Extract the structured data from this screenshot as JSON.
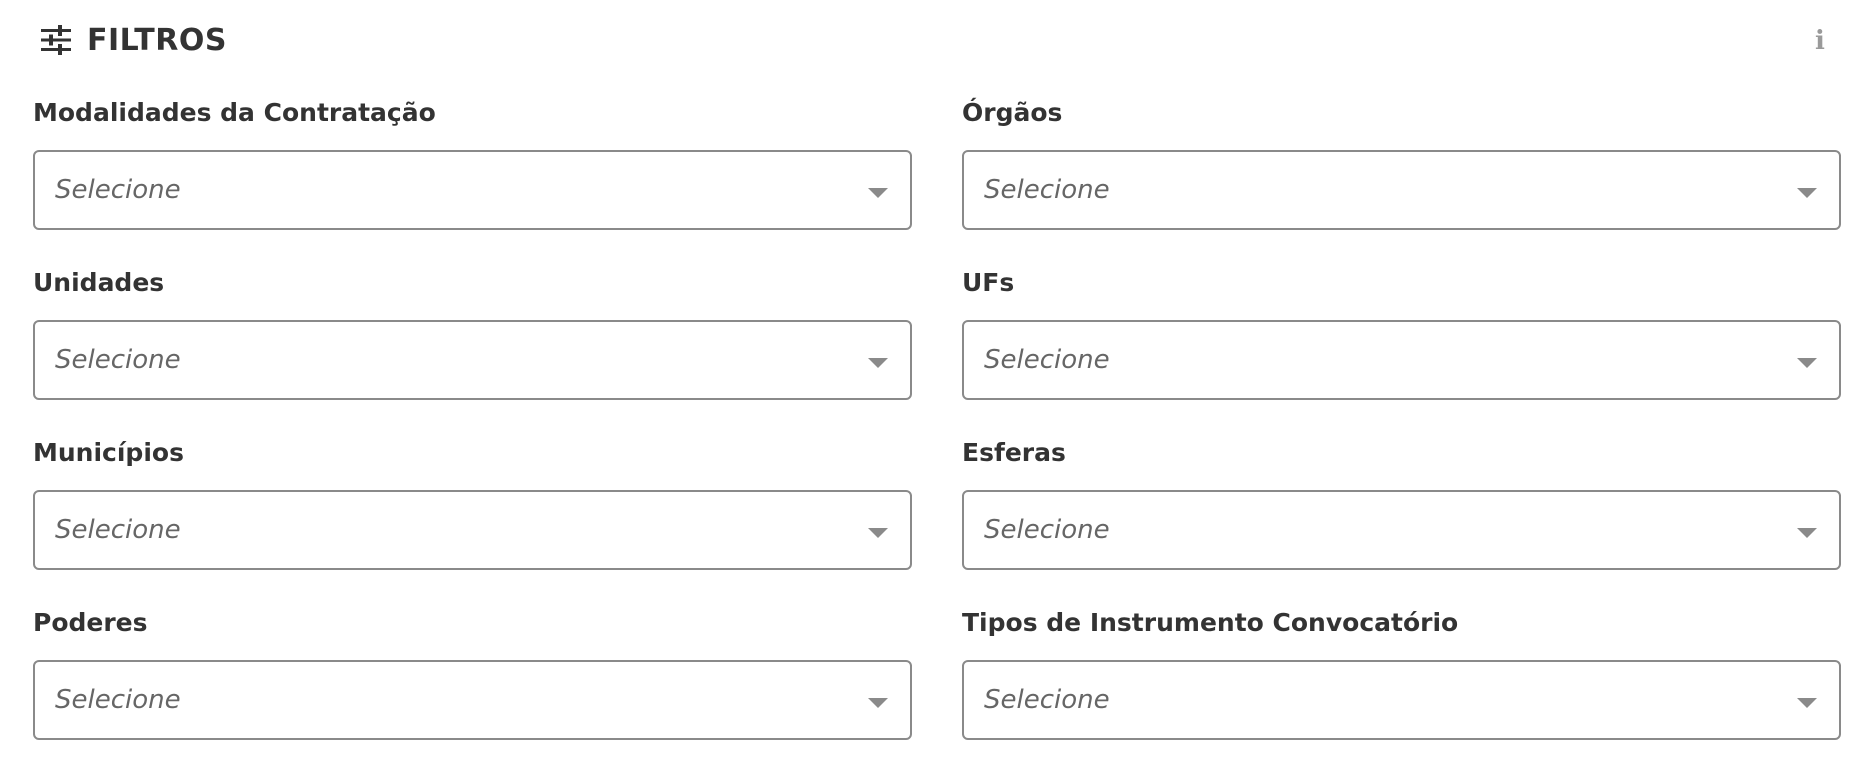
{
  "header": {
    "title": "FILTROS",
    "filter_icon": "sliders-icon",
    "info_icon": "info-icon",
    "info_glyph": "i"
  },
  "filters": [
    {
      "label": "Modalidades da Contratação",
      "placeholder": "Selecione"
    },
    {
      "label": "Órgãos",
      "placeholder": "Selecione"
    },
    {
      "label": "Unidades",
      "placeholder": "Selecione"
    },
    {
      "label": "UFs",
      "placeholder": "Selecione"
    },
    {
      "label": "Municípios",
      "placeholder": "Selecione"
    },
    {
      "label": "Esferas",
      "placeholder": "Selecione"
    },
    {
      "label": "Poderes",
      "placeholder": "Selecione"
    },
    {
      "label": "Tipos de Instrumento Convocatório",
      "placeholder": "Selecione"
    }
  ],
  "colors": {
    "text": "#333333",
    "border": "#8a8a8a",
    "placeholder": "#666666",
    "icon_muted": "#9a9a9a"
  }
}
